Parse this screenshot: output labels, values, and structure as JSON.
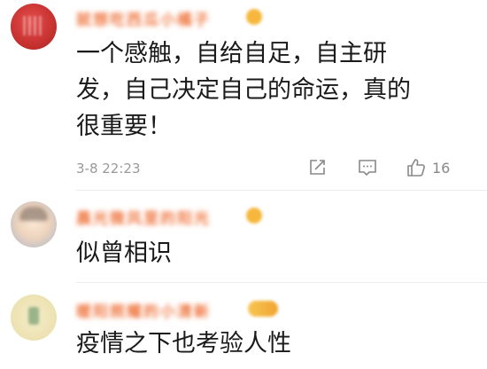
{
  "comments": [
    {
      "username": "就想吃西瓜小橘子",
      "text": "一个感触，自给自足，自主研\n发，自己决定自己的命运，真的\n很重要！",
      "timestamp": "3-8 22:23",
      "likes": "16",
      "avatar_icon": "red-avatar-icon"
    },
    {
      "username": "晨光微风里的阳光",
      "text": "似曾相识",
      "avatar_icon": "cartoon-avatar-icon"
    },
    {
      "username": "暖阳照耀的小清新",
      "text": "疫情之下也考验人性",
      "avatar_icon": "plant-avatar-icon"
    }
  ],
  "icons": {
    "share": "share-icon",
    "comment": "comment-icon",
    "like": "like-icon"
  },
  "colors": {
    "username": "#f07a45",
    "meta": "#999999",
    "text": "#1a1a1a"
  }
}
